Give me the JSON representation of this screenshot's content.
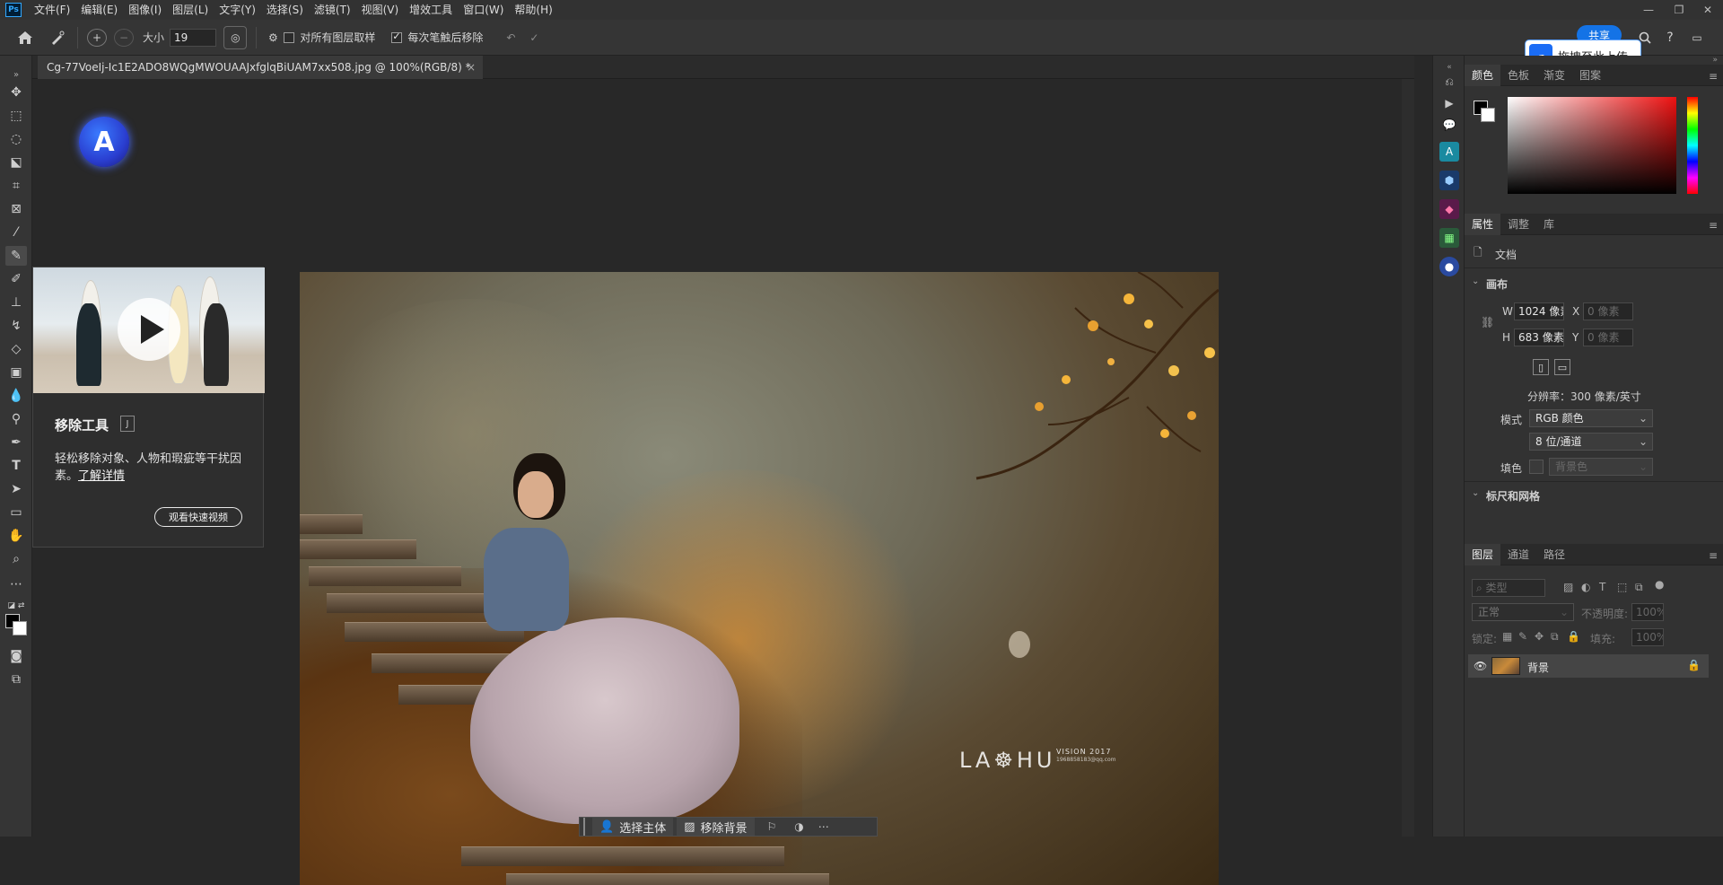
{
  "menubar": {
    "logo": "Ps",
    "items": [
      "文件(F)",
      "编辑(E)",
      "图像(I)",
      "图层(L)",
      "文字(Y)",
      "选择(S)",
      "滤镜(T)",
      "视图(V)",
      "增效工具",
      "窗口(W)",
      "帮助(H)"
    ],
    "window_controls": [
      "minimize-icon",
      "restore-icon",
      "close-icon"
    ]
  },
  "options": {
    "size_label": "大小",
    "size_value": "19",
    "sample_all_label": "对所有图层取样",
    "sample_all_checked": false,
    "remove_after_label": "每次笔触后移除",
    "remove_after_checked": true,
    "share_label": "共享",
    "upload_label": "拖拽至此上传"
  },
  "document": {
    "tab_title": "Cg-77VoeIj-Ic1E2ADO8WQgMWOUAAJxfglqBiUAM7xx508.jpg @ 100%(RGB/8) *",
    "watermark_text": "LA☸HU",
    "watermark_sub": "VISION 2017",
    "watermark_sub2": "1968858183@qq.com"
  },
  "tooltip": {
    "title": "移除工具",
    "shortcut": "J",
    "desc_text": "轻松移除对象、人物和瑕疵等干扰因素。",
    "learn_more": "了解详情",
    "watch_video": "观看快速视频"
  },
  "contextbar": {
    "select_subject": "选择主体",
    "remove_bg": "移除背景"
  },
  "color_panel": {
    "tabs": [
      "颜色",
      "色板",
      "渐变",
      "图案"
    ],
    "active_tab": 0,
    "hue_color": "#ee1111"
  },
  "properties_panel": {
    "tabs": [
      "属性",
      "调整",
      "库"
    ],
    "active_tab": 0,
    "doc_label": "文档",
    "canvas_section": "画布",
    "w_label": "W",
    "w_value": "1024 像素",
    "h_label": "H",
    "h_value": "683 像素",
    "x_label": "X",
    "x_value": "0 像素",
    "y_label": "Y",
    "y_value": "0 像素",
    "resolution": "分辨率：300 像素/英寸",
    "mode_label": "模式",
    "mode_value": "RGB 颜色",
    "depth_value": "8 位/通道",
    "fill_label": "填色",
    "fill_value": "背景色",
    "rulers_section": "标尺和网格"
  },
  "layers_panel": {
    "tabs": [
      "图层",
      "通道",
      "路径"
    ],
    "active_tab": 0,
    "search_placeholder": "类型",
    "blend_mode": "正常",
    "opacity_label": "不透明度:",
    "opacity_value": "100%",
    "lock_label": "锁定:",
    "fill_label": "填充:",
    "fill_value": "100%",
    "layers": [
      {
        "name": "背景",
        "visible": true,
        "locked": true
      }
    ]
  },
  "colors": {
    "app_bg": "#282828",
    "panel_bg": "#323232",
    "accent_blue": "#1473e6"
  }
}
